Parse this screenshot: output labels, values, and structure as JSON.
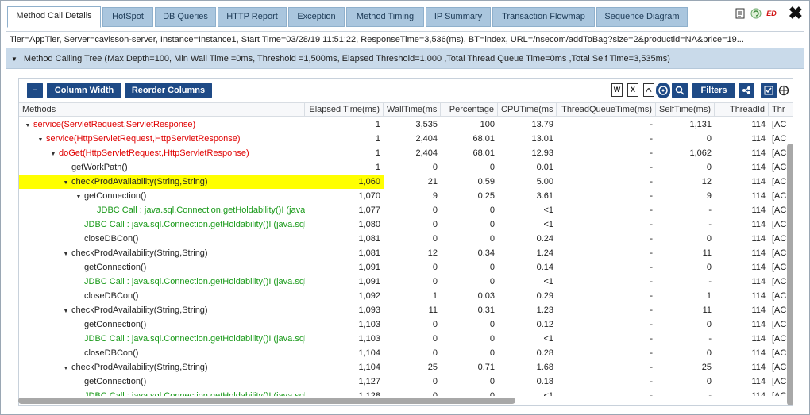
{
  "tabs": [
    {
      "label": "Method Call Details",
      "active": true
    },
    {
      "label": "HotSpot"
    },
    {
      "label": "DB Queries"
    },
    {
      "label": "HTTP Report"
    },
    {
      "label": "Exception"
    },
    {
      "label": "Method Timing"
    },
    {
      "label": "IP Summary"
    },
    {
      "label": "Transaction Flowmap"
    },
    {
      "label": "Sequence Diagram"
    }
  ],
  "top_icons": {
    "ed_label": "ED",
    "close": "✖"
  },
  "info": "Tier=AppTier, Server=cavisson-server, Instance=Instance1, Start Time=03/28/19 11:51:22, ResponseTime=3,536(ms), BT=index, URL=/nsecom/addToBag?size=2&productid=NA&price=19...",
  "tree_title": "Method Calling Tree (Max Depth=100, Min Wall Time =0ms, Threshold =1,500ms, Elapsed Threshold=1,000 ,Total Thread Queue Time=0ms ,Total Self Time=3,535ms)",
  "toolbar": {
    "collapse": "−",
    "column_width": "Column Width",
    "reorder_columns": "Reorder Columns",
    "filters": "Filters"
  },
  "columns": [
    "Methods",
    "Elapsed Time(ms)",
    "WallTime(ms",
    "Percentage",
    "CPUTime(ms",
    "ThreadQueueTime(ms)",
    "SelfTime(ms)",
    "ThreadId",
    "Thr"
  ],
  "rows": [
    {
      "depth": 0,
      "toggle": "down",
      "color": "red",
      "method": "service(ServletRequest,ServletResponse)",
      "elapsed": "1",
      "wall": "3,535",
      "pct": "100",
      "cpu": "13.79",
      "tq": "-",
      "self": "1,131",
      "tid": "114",
      "thr": "[AC"
    },
    {
      "depth": 1,
      "toggle": "down",
      "color": "red",
      "method": "service(HttpServletRequest,HttpServletResponse)",
      "elapsed": "1",
      "wall": "2,404",
      "pct": "68.01",
      "cpu": "13.01",
      "tq": "-",
      "self": "0",
      "tid": "114",
      "thr": "[AC"
    },
    {
      "depth": 2,
      "toggle": "down",
      "color": "red",
      "method": "doGet(HttpServletRequest,HttpServletResponse)",
      "elapsed": "1",
      "wall": "2,404",
      "pct": "68.01",
      "cpu": "12.93",
      "tq": "-",
      "self": "1,062",
      "tid": "114",
      "thr": "[AC"
    },
    {
      "depth": 3,
      "toggle": "",
      "color": "",
      "method": "getWorkPath()",
      "elapsed": "1",
      "wall": "0",
      "pct": "0",
      "cpu": "0.01",
      "tq": "-",
      "self": "0",
      "tid": "114",
      "thr": "[AC"
    },
    {
      "depth": 3,
      "toggle": "down",
      "color": "",
      "method": "checkProdAvailability(String,String)",
      "elapsed": "1,060",
      "wall": "21",
      "pct": "0.59",
      "cpu": "5.00",
      "tq": "-",
      "self": "12",
      "tid": "114",
      "thr": "[AC",
      "highlight": true
    },
    {
      "depth": 4,
      "toggle": "down",
      "color": "",
      "method": "getConnection()",
      "elapsed": "1,070",
      "wall": "9",
      "pct": "0.25",
      "cpu": "3.61",
      "tq": "-",
      "self": "9",
      "tid": "114",
      "thr": "[AC"
    },
    {
      "depth": 5,
      "toggle": "",
      "color": "green",
      "method": "JDBC Call : java.sql.Connection.getHoldability()I (java.sql.Connection)",
      "elapsed": "1,077",
      "wall": "0",
      "pct": "0",
      "cpu": "<1",
      "tq": "-",
      "self": "-",
      "tid": "114",
      "thr": "[AC"
    },
    {
      "depth": 4,
      "toggle": "",
      "color": "green",
      "method": "JDBC Call : java.sql.Connection.getHoldability()I (java.sql.Connection)",
      "elapsed": "1,080",
      "wall": "0",
      "pct": "0",
      "cpu": "<1",
      "tq": "-",
      "self": "-",
      "tid": "114",
      "thr": "[AC"
    },
    {
      "depth": 4,
      "toggle": "",
      "color": "",
      "method": "closeDBCon()",
      "elapsed": "1,081",
      "wall": "0",
      "pct": "0",
      "cpu": "0.24",
      "tq": "-",
      "self": "0",
      "tid": "114",
      "thr": "[AC"
    },
    {
      "depth": 3,
      "toggle": "down",
      "color": "",
      "method": "checkProdAvailability(String,String)",
      "elapsed": "1,081",
      "wall": "12",
      "pct": "0.34",
      "cpu": "1.24",
      "tq": "-",
      "self": "11",
      "tid": "114",
      "thr": "[AC"
    },
    {
      "depth": 4,
      "toggle": "",
      "color": "",
      "method": "getConnection()",
      "elapsed": "1,091",
      "wall": "0",
      "pct": "0",
      "cpu": "0.14",
      "tq": "-",
      "self": "0",
      "tid": "114",
      "thr": "[AC"
    },
    {
      "depth": 4,
      "toggle": "",
      "color": "green",
      "method": "JDBC Call : java.sql.Connection.getHoldability()I (java.sql.Connection)",
      "elapsed": "1,091",
      "wall": "0",
      "pct": "0",
      "cpu": "<1",
      "tq": "-",
      "self": "-",
      "tid": "114",
      "thr": "[AC"
    },
    {
      "depth": 4,
      "toggle": "",
      "color": "",
      "method": "closeDBCon()",
      "elapsed": "1,092",
      "wall": "1",
      "pct": "0.03",
      "cpu": "0.29",
      "tq": "-",
      "self": "1",
      "tid": "114",
      "thr": "[AC"
    },
    {
      "depth": 3,
      "toggle": "down",
      "color": "",
      "method": "checkProdAvailability(String,String)",
      "elapsed": "1,093",
      "wall": "11",
      "pct": "0.31",
      "cpu": "1.23",
      "tq": "-",
      "self": "11",
      "tid": "114",
      "thr": "[AC"
    },
    {
      "depth": 4,
      "toggle": "",
      "color": "",
      "method": "getConnection()",
      "elapsed": "1,103",
      "wall": "0",
      "pct": "0",
      "cpu": "0.12",
      "tq": "-",
      "self": "0",
      "tid": "114",
      "thr": "[AC"
    },
    {
      "depth": 4,
      "toggle": "",
      "color": "green",
      "method": "JDBC Call : java.sql.Connection.getHoldability()I (java.sql.Connection)",
      "elapsed": "1,103",
      "wall": "0",
      "pct": "0",
      "cpu": "<1",
      "tq": "-",
      "self": "-",
      "tid": "114",
      "thr": "[AC"
    },
    {
      "depth": 4,
      "toggle": "",
      "color": "",
      "method": "closeDBCon()",
      "elapsed": "1,104",
      "wall": "0",
      "pct": "0",
      "cpu": "0.28",
      "tq": "-",
      "self": "0",
      "tid": "114",
      "thr": "[AC"
    },
    {
      "depth": 3,
      "toggle": "down",
      "color": "",
      "method": "checkProdAvailability(String,String)",
      "elapsed": "1,104",
      "wall": "25",
      "pct": "0.71",
      "cpu": "1.68",
      "tq": "-",
      "self": "25",
      "tid": "114",
      "thr": "[AC"
    },
    {
      "depth": 4,
      "toggle": "",
      "color": "",
      "method": "getConnection()",
      "elapsed": "1,127",
      "wall": "0",
      "pct": "0",
      "cpu": "0.18",
      "tq": "-",
      "self": "0",
      "tid": "114",
      "thr": "[AC"
    },
    {
      "depth": 4,
      "toggle": "",
      "color": "green",
      "method": "JDBC Call : java.sql.Connection.getHoldability()I (java.sql.Connection)",
      "elapsed": "1,128",
      "wall": "0",
      "pct": "0",
      "cpu": "<1",
      "tq": "-",
      "self": "-",
      "tid": "114",
      "thr": "[AC"
    }
  ]
}
